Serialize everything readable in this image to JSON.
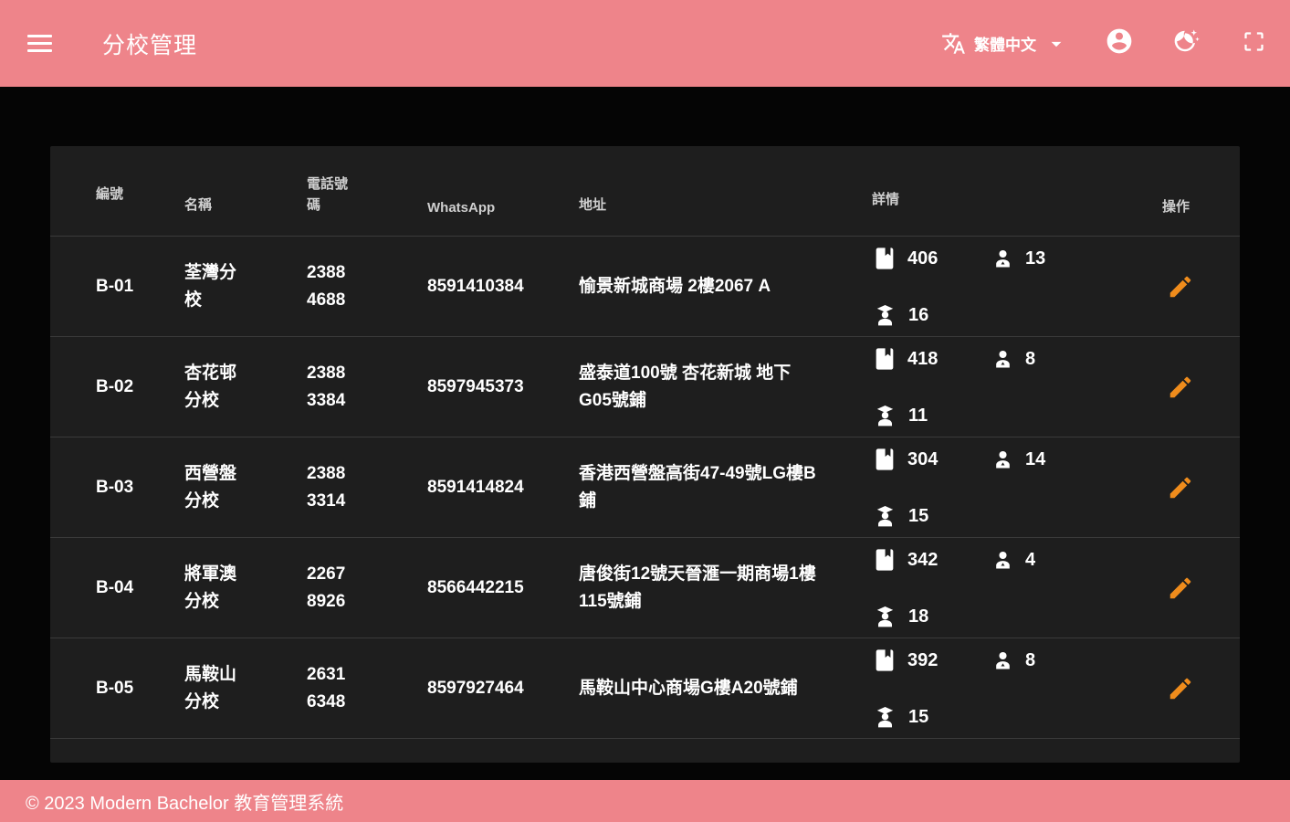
{
  "appbar": {
    "title": "分校管理",
    "language": "繁體中文"
  },
  "table": {
    "headers": {
      "id": "編號",
      "name": "名稱",
      "phone": "電話號碼",
      "whatsapp": "WhatsApp",
      "address": "地址",
      "details": "詳情",
      "actions": "操作"
    },
    "rows": [
      {
        "id": "B-01",
        "name": "荃灣分校",
        "phone": "2388 4688",
        "whatsapp": "8591410384",
        "address": "愉景新城商場 2樓2067 A",
        "book_count": "406",
        "person_count": "13",
        "graduate_count": "16"
      },
      {
        "id": "B-02",
        "name": "杏花邨分校",
        "phone": "2388 3384",
        "whatsapp": "8597945373",
        "address": "盛泰道100號 杏花新城 地下 G05號鋪",
        "book_count": "418",
        "person_count": "8",
        "graduate_count": "11"
      },
      {
        "id": "B-03",
        "name": "西營盤分校",
        "phone": "2388 3314",
        "whatsapp": "8591414824",
        "address": "香港西營盤高街47-49號LG樓B鋪",
        "book_count": "304",
        "person_count": "14",
        "graduate_count": "15"
      },
      {
        "id": "B-04",
        "name": "將軍澳分校",
        "phone": "2267 8926",
        "whatsapp": "8566442215",
        "address": "唐俊街12號天晉滙一期商場1樓115號鋪",
        "book_count": "342",
        "person_count": "4",
        "graduate_count": "18"
      },
      {
        "id": "B-05",
        "name": "馬鞍山分校",
        "phone": "2631 6348",
        "whatsapp": "8597927464",
        "address": "馬鞍山中心商場G樓A20號鋪",
        "book_count": "392",
        "person_count": "8",
        "graduate_count": "15"
      }
    ]
  },
  "footer": {
    "copyright": "© 2023 Modern Bachelor 教育管理系統"
  },
  "colors": {
    "appbar_pink": "#ee848a",
    "card_background": "#1e1e1e",
    "edit_orange": "#ef8c1c"
  }
}
